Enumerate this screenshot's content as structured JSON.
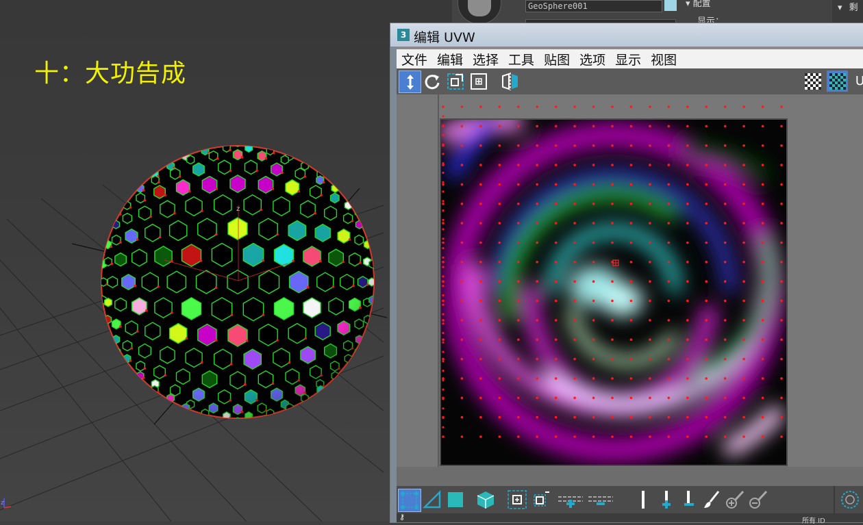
{
  "viewport": {
    "caption": "十：大功告成",
    "object": "geosphere-with-hex-uv-pattern",
    "colors": {
      "caption": "#f2f200",
      "background": "#3c3c3c",
      "wire": "#27e22a",
      "vertex": "#ff1a1a",
      "cell_palette": [
        "#000000",
        "#ff2bd0",
        "#6b6bff",
        "#22e6e6",
        "#ffffff",
        "#ff4d7a",
        "#ffb3e6",
        "#cc00cc",
        "#0b5a0b",
        "#4dff4d",
        "#1aa8a8",
        "#c41414",
        "#2a1a8a",
        "#d9ff1a",
        "#a64dff"
      ]
    }
  },
  "command_panel": {
    "object_name": "GeoSphere001",
    "rollout_title": "配置",
    "rollout_sub": "显示：",
    "right_header": "剩",
    "colors": {
      "object_color": "#9fd6e6"
    }
  },
  "uvw_editor": {
    "title": "编辑 UVW",
    "title_icon": "3",
    "menu": [
      "文件",
      "编辑",
      "选择",
      "工具",
      "贴图",
      "选项",
      "显示",
      "视图"
    ],
    "toolbar_icons": [
      "move-icon",
      "rotate-icon",
      "scale-icon",
      "freeform-icon",
      "mirror-icon"
    ],
    "toolbar_right_icons": [
      "checker-pattern-icon",
      "checker-teal-icon"
    ],
    "toolbar_right_label": "U",
    "bottom_icons": [
      "vertex-select-icon",
      "edge-select-icon",
      "face-select-icon",
      "element-cube-icon",
      "grow-select-icon",
      "shrink-select-icon",
      "loop-icon",
      "ring-icon",
      "soft-select-icon",
      "paint-select-icon"
    ],
    "status_label": "所有 ID",
    "colors": {
      "titlebar": "#c8d3e0",
      "uv_points": "#ff1a1a",
      "active_tool": "#4b7fd2"
    },
    "grid": {
      "columns": 19,
      "rows": 18
    }
  }
}
